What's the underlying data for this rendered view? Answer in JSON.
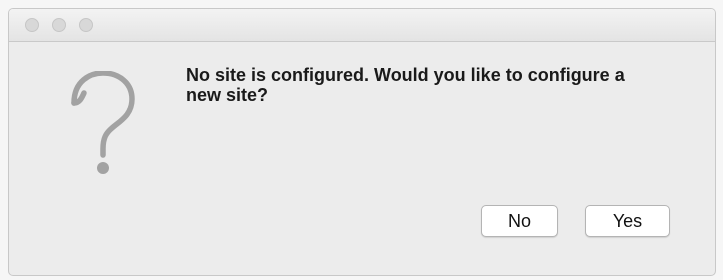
{
  "window": {
    "title": ""
  },
  "dialog": {
    "icon": "question-mark-icon",
    "message": "No site is configured. Would you like to configure a new site?",
    "buttons": {
      "no_label": "No",
      "yes_label": "Yes"
    }
  },
  "colors": {
    "window_bg": "#ececec",
    "titlebar_bg": "#e8e8e8",
    "icon_gray": "#9a9a9a",
    "button_bg": "#ffffff"
  }
}
